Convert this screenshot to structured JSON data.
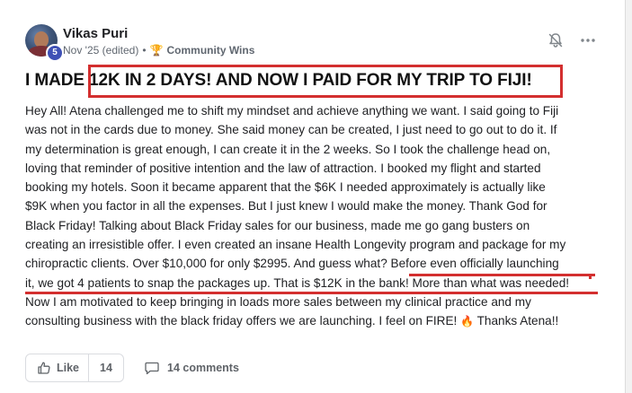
{
  "author": {
    "name": "Vikas Puri",
    "level": "5",
    "avatar_icon": "user-photo"
  },
  "meta": {
    "date": "Nov '25 (edited)",
    "separator": "•",
    "category_icon": "trophy-icon",
    "category": "Community Wins"
  },
  "actions": {
    "notify_icon": "bell-off-icon",
    "more_icon": "more-horizontal-icon"
  },
  "post": {
    "title": "I MADE 12K IN 2 DAYS! AND NOW I PAID FOR MY TRIP TO FIJI!",
    "body_lines": [
      "Hey All! Atena challenged me to shift my mindset and achieve anything we want. I said going to Fiji",
      "was not in the cards due to money. She said money can be created, I just need to go out to do it. If",
      "my determination is great enough, I can create it in the 2 weeks. So I took the challenge head on,",
      "loving that reminder of positive intention and the law of attraction. I booked my flight and started",
      "booking my hotels. Soon it became apparent that the $6K I needed approximately is actually like",
      "$9K when you factor in all the expenses. But I just knew I would make the money. Thank God for",
      "Black Friday! Talking about Black Friday sales for our business, made me go gang busters on",
      "creating an irresistible offer. I even created an insane Health Longevity program and package for my",
      "chiropractic clients. Over $10,000 for only $2995. And guess what? Before even officially launching",
      "it, we got 4 patients to snap the packages up. That is $12K in the bank! More than what was needed!",
      "Now I am motivated to keep bringing in loads more sales between my clinical practice and my",
      "consulting business with the black friday offers we are launching. I feel on FIRE!"
    ],
    "fire_emoji": "🔥",
    "closing": " Thanks Atena!!"
  },
  "footer": {
    "like_label": "Like",
    "like_count": "14",
    "comments_label": "14 comments",
    "like_icon": "thumbs-up-icon",
    "comment_icon": "comment-icon"
  },
  "colors": {
    "highlight_red": "#d32f2f",
    "badge_blue": "#3f51b5",
    "text_dark": "#202124",
    "text_muted": "#606770"
  }
}
